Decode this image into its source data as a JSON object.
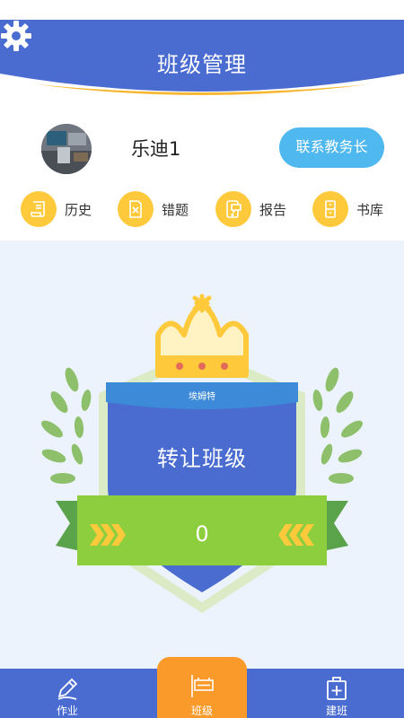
{
  "header": {
    "title": "班级管理",
    "icon": "gear-icon"
  },
  "profile": {
    "name": "乐迪1",
    "contact_label": "联系教务长"
  },
  "quick_actions": [
    {
      "label": "历史",
      "icon": "scroll-icon"
    },
    {
      "label": "错题",
      "icon": "wrong-sheet-icon"
    },
    {
      "label": "报告",
      "icon": "report-phone-icon"
    },
    {
      "label": "书库",
      "icon": "cabinet-icon"
    }
  ],
  "badge": {
    "name": "埃姆特",
    "action": "转让班级",
    "count": "0",
    "stars": 3
  },
  "tabs": [
    {
      "label": "作业",
      "icon": "pencil-icon",
      "active": false
    },
    {
      "label": "班级",
      "icon": "class-sign-icon",
      "active": true
    },
    {
      "label": "建班",
      "icon": "add-class-icon",
      "active": false
    }
  ],
  "colors": {
    "primary": "#4a6cd1",
    "accent": "#fa9a2b",
    "contact": "#4fb8ef",
    "icon_bg": "#ffc93c",
    "ribbon": "#8dce3f",
    "shield": "#4a6cd1"
  }
}
